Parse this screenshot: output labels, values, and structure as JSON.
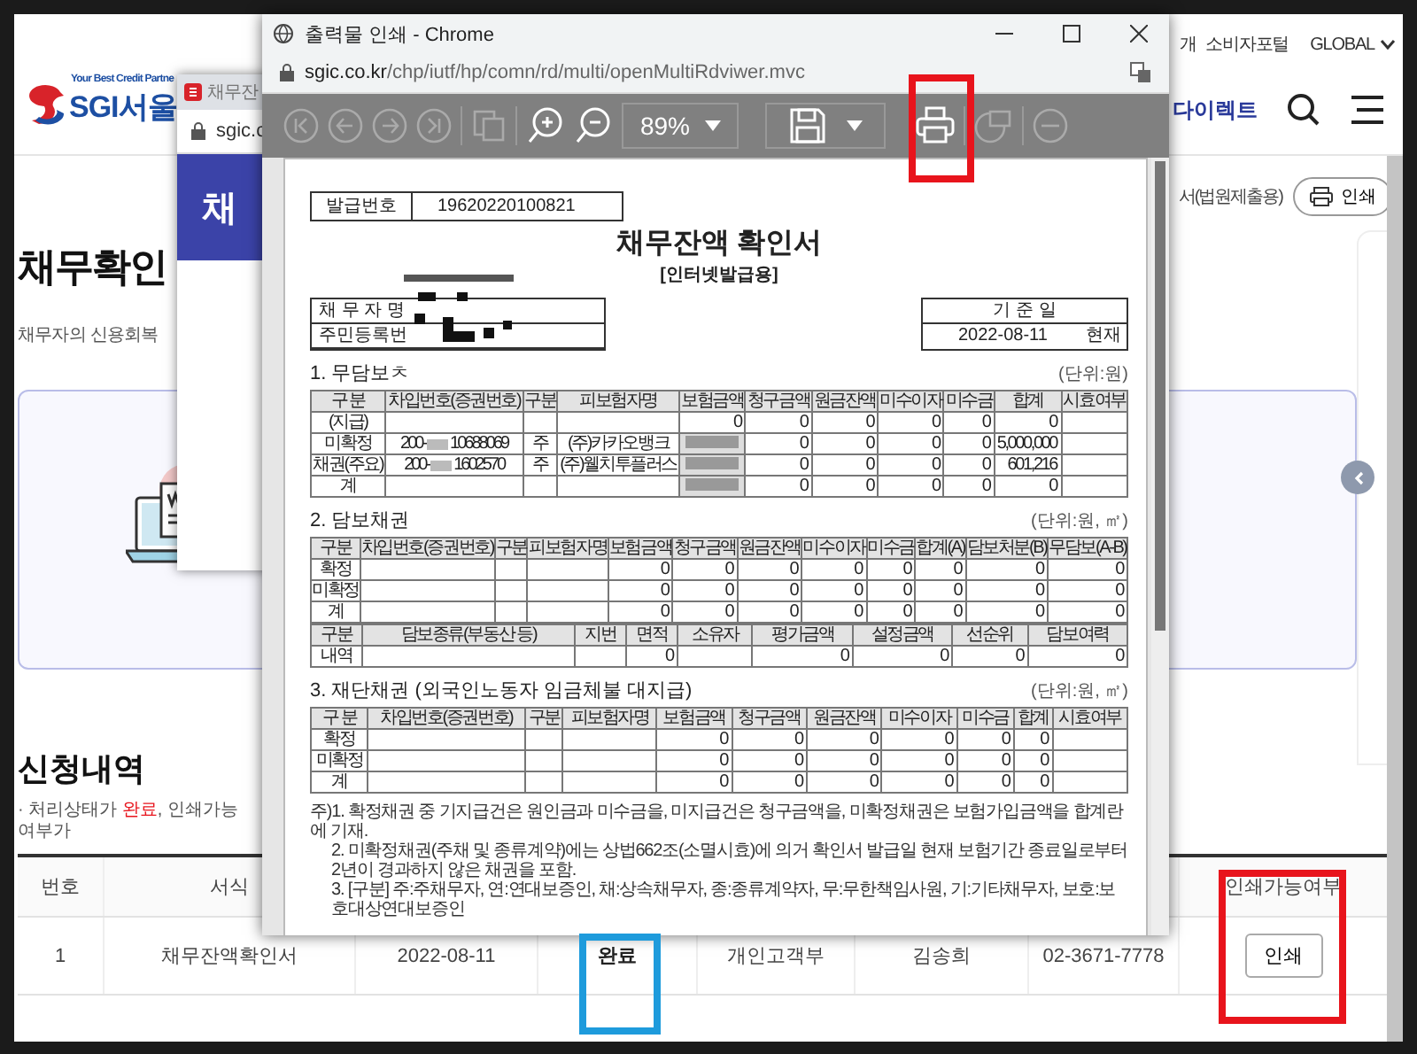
{
  "site": {
    "tagline": "Your Best Credit Partne",
    "logo_text": "SGI서울",
    "top_links": [
      "개",
      "소비자포털",
      "GLOBAL"
    ],
    "nav_label": "다이렉트"
  },
  "page": {
    "title": "채무확인",
    "subtitle": "채무자의 신용회복",
    "doc_label": "서(법원제출용)",
    "print_button": "인쇄"
  },
  "history": {
    "title": "신청내역",
    "note": [
      {
        "text": "· 처리상태가 ",
        "highlight": false
      },
      {
        "text": "완료",
        "highlight": true
      },
      {
        "text": ", 인쇄가능 여부가",
        "highlight": false
      }
    ],
    "columns": [
      {
        "label": "번호"
      },
      {
        "label": "서식"
      },
      {},
      {},
      {},
      {},
      {},
      {
        "label": "인쇄가능여부"
      }
    ],
    "rows": [
      {
        "cells": [
          {
            "kind": "text",
            "text": "1"
          },
          {
            "kind": "text",
            "text": "채무잔액확인서"
          },
          {
            "kind": "text",
            "text": "2022-08-11"
          },
          {
            "kind": "strong",
            "text": "완료"
          },
          {
            "kind": "text",
            "text": "개인고객부"
          },
          {
            "kind": "text",
            "text": "김송희"
          },
          {
            "kind": "text",
            "text": "02-3671-7778"
          },
          {
            "kind": "button",
            "text": "인쇄"
          }
        ]
      }
    ]
  },
  "back_window": {
    "tab_title": "채무잔",
    "url": "sgic.c",
    "banner_text": "채"
  },
  "popup": {
    "title": "출력물 인쇄 - Chrome",
    "url_host": "sgic.co.kr",
    "url_path": "/chp/iutf/hp/comn/rd/multi/openMultiRdviwer.mvc",
    "zoom": "89%"
  },
  "document": {
    "issue_label": "발급번호",
    "issue_number": "19620220100821",
    "title": "채무잔액 확인서",
    "subtitle": "[인터넷발급용]",
    "debtor_labels": [
      "채 무 자 명",
      "주민등록번"
    ],
    "base_date_label": "기 준 일",
    "base_date": "2022-08-11",
    "base_date_suffix": "현재",
    "sections": [
      {
        "title": "1. 무담보ㅊ",
        "unit": "(단위:원)",
        "tables": [
          {
            "columns": [
              "구 분",
              "차입번호(증권번호)",
              "구분",
              "피보험자명",
              "보험금액",
              "청구금액",
              "원금잔액",
              "미수이자",
              "미수금",
              "합계",
              "시효여부"
            ],
            "rows": [
              [
                "(지급)",
                "",
                "",
                "",
                "0",
                "0",
                "0",
                "0",
                "0",
                "0",
                ""
              ],
              [
                "미확정",
                [
                  "200-",
                  "10688069"
                ],
                "주",
                "(주)카카오뱅크",
                {
                  "redacted": true
                },
                "0",
                "0",
                "0",
                "0",
                "5,000,000",
                ""
              ],
              [
                "채권(주요)",
                [
                  "200-",
                  "1602570"
                ],
                "주",
                "(주)웰치투플러스",
                {
                  "redacted": true
                },
                "0",
                "0",
                "0",
                "0",
                "601,216",
                ""
              ],
              [
                "계",
                "",
                "",
                "",
                {
                  "redacted": true
                },
                "0",
                "0",
                "0",
                "0",
                "0",
                ""
              ]
            ]
          }
        ]
      },
      {
        "title": "2. 담보채권",
        "unit": "(단위:원, ㎡)",
        "tables": [
          {
            "columns": [
              "구분",
              "차입번호(증권번호)",
              "구분",
              "피보험자명",
              "보험금액",
              "청구금액",
              "원금잔액",
              "미수이자",
              "미수금",
              "합계(A)",
              "담보처분(B)",
              "무담보(A-B)"
            ],
            "rows": [
              [
                "확정",
                "",
                "",
                "",
                "0",
                "0",
                "0",
                "0",
                "0",
                "0",
                "0",
                "0"
              ],
              [
                "미확정",
                "",
                "",
                "",
                "0",
                "0",
                "0",
                "0",
                "0",
                "0",
                "0",
                "0"
              ],
              [
                "계",
                "",
                "",
                "",
                "0",
                "0",
                "0",
                "0",
                "0",
                "0",
                "0",
                "0"
              ]
            ]
          },
          {
            "columns": [
              "구분",
              "담보종류(부동산 등)",
              "지번",
              "면적",
              "소유자",
              "평가금액",
              "설정금액",
              "선순위",
              "담보여력"
            ],
            "rows": [
              [
                "내역",
                "",
                "",
                "0",
                "",
                "0",
                "0",
                "0",
                "0"
              ]
            ]
          }
        ]
      },
      {
        "title": "3. 재단채권 (외국인노동자 임금체불 대지급)",
        "unit": "(단위:원, ㎡)",
        "tables": [
          {
            "columns": [
              "구 분",
              "차입번호(증권번호)",
              "구분",
              "피보험자명",
              "보험금액",
              "청구금액",
              "원금잔액",
              "미수이자",
              "미수금",
              "합계",
              "시효여부"
            ],
            "rows": [
              [
                "확정",
                "",
                "",
                "",
                "0",
                "0",
                "0",
                "0",
                "0",
                "0",
                ""
              ],
              [
                "미확정",
                "",
                "",
                "",
                "0",
                "0",
                "0",
                "0",
                "0",
                "0",
                ""
              ],
              [
                "계",
                "",
                "",
                "",
                "0",
                "0",
                "0",
                "0",
                "0",
                "0",
                ""
              ]
            ]
          }
        ]
      }
    ],
    "notes": [
      "주)1. 확정채권 중 기지급건은 원인금과 미수금을, 미지급건은 청구금액을, 미확정채권은 보험가입금액을 합계란에 기재.",
      "2. 미확정채권(주채 및 종류계약)에는 상법662조(소멸시효)에 의거 확인서 발급일 현재 보험기간 종료일로부터 2년이 경과하지 않은 채권을 포함.",
      "3. [구분] 주:주채무자, 연:연대보증인, 채:상속채무자, 종:종류계약자, 무:무한책임사원, 기:기타채무자, 보호:보호대상연대보증인"
    ]
  },
  "annotations": [
    {
      "color": "#e8141c"
    },
    {
      "color": "#e8141c"
    },
    {
      "color": "#1e9bdc"
    }
  ]
}
